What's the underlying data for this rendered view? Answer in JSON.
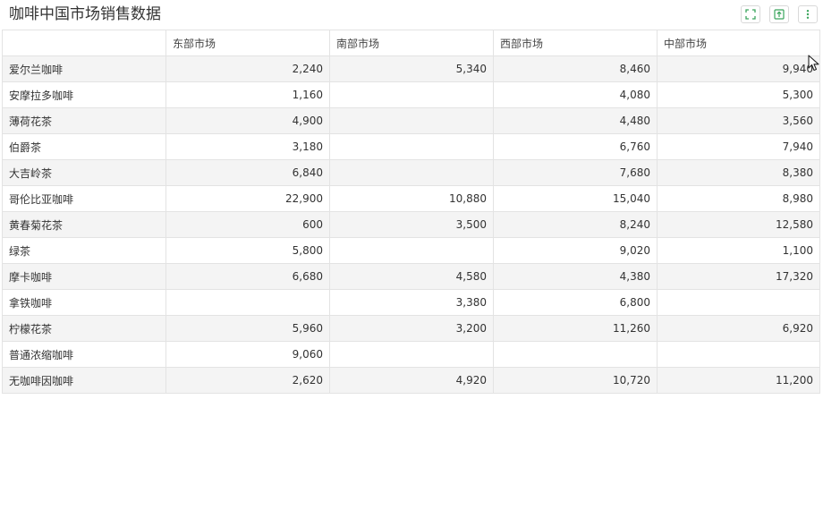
{
  "title": "咖啡中国市场销售数据",
  "toolbar": {
    "icons": [
      "fullscreen-icon",
      "export-icon",
      "more-vertical-icon"
    ],
    "accent": "#3aa55c"
  },
  "table": {
    "columns": [
      "",
      "东部市场",
      "南部市场",
      "西部市场",
      "中部市场"
    ],
    "rows": [
      [
        "爱尔兰咖啡",
        "2,240",
        "5,340",
        "8,460",
        "9,940"
      ],
      [
        "安摩拉多咖啡",
        "1,160",
        "",
        "4,080",
        "5,300"
      ],
      [
        "薄荷花茶",
        "4,900",
        "",
        "4,480",
        "3,560"
      ],
      [
        "伯爵茶",
        "3,180",
        "",
        "6,760",
        "7,940"
      ],
      [
        "大吉岭茶",
        "6,840",
        "",
        "7,680",
        "8,380"
      ],
      [
        "哥伦比亚咖啡",
        "22,900",
        "10,880",
        "15,040",
        "8,980"
      ],
      [
        "黄春菊花茶",
        "600",
        "3,500",
        "8,240",
        "12,580"
      ],
      [
        "绿茶",
        "5,800",
        "",
        "9,020",
        "1,100"
      ],
      [
        "摩卡咖啡",
        "6,680",
        "4,580",
        "4,380",
        "17,320"
      ],
      [
        "拿铁咖啡",
        "",
        "3,380",
        "6,800",
        ""
      ],
      [
        "柠檬花茶",
        "5,960",
        "3,200",
        "11,260",
        "6,920"
      ],
      [
        "普通浓缩咖啡",
        "9,060",
        "",
        "",
        ""
      ],
      [
        "无咖啡因咖啡",
        "2,620",
        "4,920",
        "10,720",
        "11,200"
      ]
    ]
  }
}
